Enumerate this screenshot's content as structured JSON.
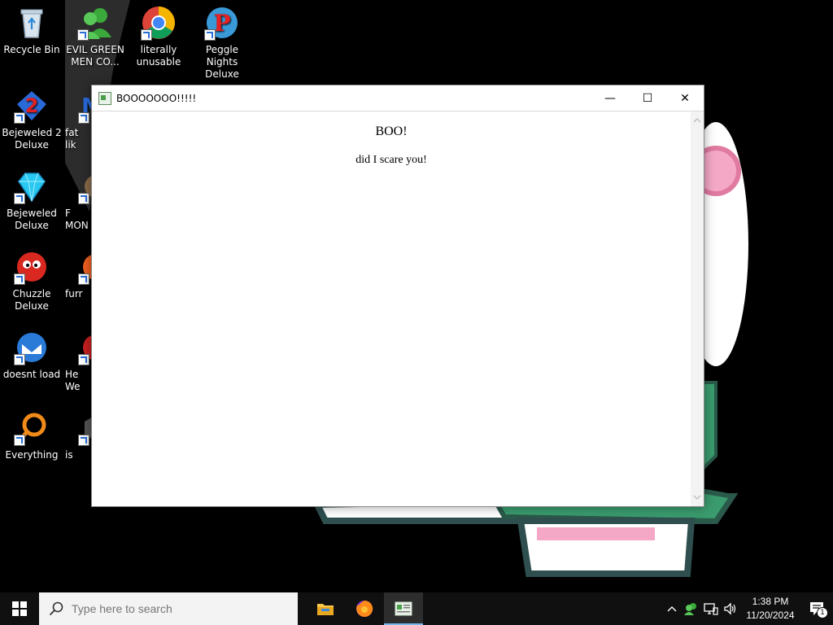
{
  "desktop": {
    "icons": [
      {
        "label": "Recycle Bin"
      },
      {
        "label": "EVIL GREEN MEN CO..."
      },
      {
        "label": "literally unusable"
      },
      {
        "label": "Peggle Nights Deluxe"
      },
      {
        "label": "Bejeweled 2 Deluxe"
      },
      {
        "label": "fat lik"
      },
      {
        "label": "Bejeweled Deluxe"
      },
      {
        "label": "F MON"
      },
      {
        "label": "Chuzzle Deluxe"
      },
      {
        "label": "furr"
      },
      {
        "label": "doesnt load"
      },
      {
        "label": "He We"
      },
      {
        "label": "Everything"
      },
      {
        "label": "is"
      }
    ]
  },
  "window": {
    "title": "BOOOOOOO!!!!!",
    "minimize_glyph": "—",
    "maximize_glyph": "☐",
    "close_glyph": "✕",
    "content": {
      "heading": "BOO!",
      "text": "did I scare you!"
    }
  },
  "taskbar": {
    "search_placeholder": "Type here to search",
    "apps": [
      "file-explorer",
      "firefox",
      "web-page-app"
    ],
    "clock_time": "1:38 PM",
    "clock_date": "11/20/2024",
    "notification_count": "1"
  },
  "colors": {
    "taskbar": "#101010",
    "accent": "#76b9ed",
    "desktop": "#000000"
  }
}
